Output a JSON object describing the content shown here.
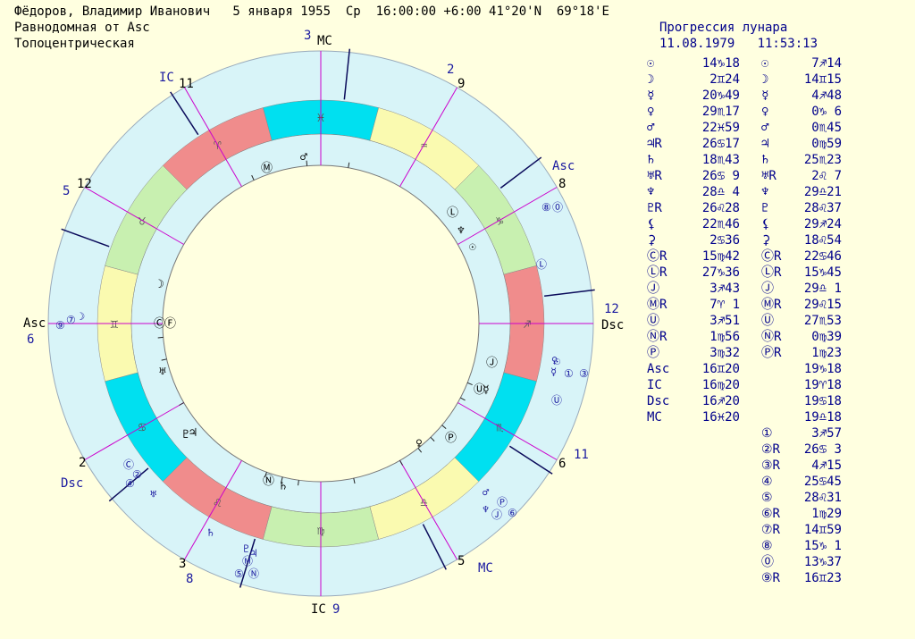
{
  "header": {
    "line1": "Фёдоров, Владимир Иванович   5 января 1955  Ср  16:00:00 +6:00 41°20'N  69°18'E",
    "line2": "Равнодомная от Asc",
    "line3": "Топоцентрическая"
  },
  "wheel": {
    "colors": {
      "outer_ring": "#d8f4f8",
      "fire": "#f08c8c",
      "earth": "#c8f0b0",
      "air": "#fafab0",
      "water": "#00e0f0",
      "inner_ring": "#d8f4f8",
      "background": "#ffffe0",
      "axis": "#cc00cc",
      "cusp_line": "#0a0a5a",
      "house_number": "#000000",
      "label_blue": "#1a1aa0"
    },
    "signs": [
      "♓",
      "♒",
      "♑",
      "♐",
      "♏",
      "♎",
      "♍",
      "♌",
      "♋",
      "♊",
      "♉",
      "♈"
    ],
    "outer_labels": [
      {
        "text": "3",
        "color": "#1a1aa0"
      },
      {
        "text": "MC",
        "color": "#000000"
      },
      {
        "text": "2",
        "color": "#1a1aa0"
      },
      {
        "text": "9",
        "color": "#000000"
      },
      {
        "text": "Asc",
        "color": "#1a1aa0"
      },
      {
        "text": "8",
        "color": "#000000"
      },
      {
        "text": "12",
        "color": "#1a1aa0"
      },
      {
        "text": "Dsc",
        "color": "#000000"
      },
      {
        "text": "11",
        "color": "#1a1aa0"
      },
      {
        "text": "6",
        "color": "#000000"
      },
      {
        "text": "MC",
        "color": "#1a1aa0"
      },
      {
        "text": "5",
        "color": "#000000"
      },
      {
        "text": "IC",
        "color": "#000000"
      },
      {
        "text": "9",
        "color": "#1a1aa0"
      },
      {
        "text": "3",
        "color": "#000000"
      },
      {
        "text": "8",
        "color": "#1a1aa0"
      },
      {
        "text": "2",
        "color": "#000000"
      },
      {
        "text": "Dsc",
        "color": "#1a1aa0"
      },
      {
        "text": "Asc",
        "color": "#000000"
      },
      {
        "text": "6",
        "color": "#1a1aa0"
      },
      {
        "text": "5",
        "color": "#1a1aa0"
      },
      {
        "text": "12",
        "color": "#000000"
      },
      {
        "text": "IC",
        "color": "#1a1aa0"
      },
      {
        "text": "11",
        "color": "#000000"
      }
    ],
    "inner_glyphs": [
      "♂",
      "Ⓜ",
      "Ⓛ",
      "♆",
      "☉",
      "☽",
      "Ⓒ",
      "♅",
      "♇",
      "Ⓝ",
      "♄",
      "♃",
      "♀",
      "☿",
      "Ⓙ",
      "Ⓤ",
      "Ⓟ",
      "Ⓕ"
    ],
    "outer_glyphs": [
      "☽",
      "⑦",
      "⑨",
      "②",
      "④",
      "Ⓒ",
      "♅",
      "♃",
      "♄",
      "⑤",
      "Ⓝ",
      "Ⓜ",
      "♇",
      "♆",
      "Ⓙ",
      "⑥",
      "Ⓟ",
      "♂",
      "☿",
      "♀",
      "Ⓛ",
      "⑧",
      "⓪",
      "①",
      "③",
      "Ⓤ",
      "☉"
    ]
  },
  "table": {
    "title_line1": "Прогрессия лунара",
    "title_line2": "11.08.1979   11:53:13",
    "rows": [
      {
        "l1": "☉",
        "v1": "14♑18",
        "l2": "☉",
        "v2": "7♐14"
      },
      {
        "l1": "☽",
        "v1": "2♊24",
        "l2": "☽",
        "v2": "14♊15"
      },
      {
        "l1": "☿",
        "v1": "20♑49",
        "l2": "☿",
        "v2": "4♐48"
      },
      {
        "l1": "♀",
        "v1": "29♏17",
        "l2": "♀",
        "v2": "0♑ 6"
      },
      {
        "l1": "♂",
        "v1": "22♓59",
        "l2": "♂",
        "v2": "0♏45"
      },
      {
        "l1": "♃R",
        "v1": "26♋17",
        "l2": "♃",
        "v2": "0♍59"
      },
      {
        "l1": "♄",
        "v1": "18♏43",
        "l2": "♄",
        "v2": "25♏23"
      },
      {
        "l1": "♅R",
        "v1": "26♋ 9",
        "l2": "♅R",
        "v2": "2♌ 7"
      },
      {
        "l1": "♆",
        "v1": "28♎ 4",
        "l2": "♆",
        "v2": "29♎21"
      },
      {
        "l1": "♇R",
        "v1": "26♌28",
        "l2": "♇",
        "v2": "28♌37"
      },
      {
        "l1": "⚸",
        "v1": "22♏46",
        "l2": "⚸",
        "v2": "29♐24"
      },
      {
        "l1": "⚳",
        "v1": "2♋36",
        "l2": "⚳",
        "v2": "18♌54"
      },
      {
        "l1": "ⒸR",
        "v1": "15♍42",
        "l2": "ⒸR",
        "v2": "22♋46"
      },
      {
        "l1": "ⓁR",
        "v1": "27♑36",
        "l2": "ⓁR",
        "v2": "15♑45"
      },
      {
        "l1": "Ⓙ",
        "v1": "3♐43",
        "l2": "Ⓙ",
        "v2": "29♎ 1"
      },
      {
        "l1": "ⓂR",
        "v1": "7♈ 1",
        "l2": "ⓂR",
        "v2": "29♌15"
      },
      {
        "l1": "Ⓤ",
        "v1": "3♐51",
        "l2": "Ⓤ",
        "v2": "27♏53"
      },
      {
        "l1": "ⓃR",
        "v1": "1♍56",
        "l2": "ⓃR",
        "v2": "0♍39"
      },
      {
        "l1": "Ⓟ",
        "v1": "3♍32",
        "l2": "ⓅR",
        "v2": "1♍23"
      },
      {
        "l1": "Asc",
        "v1": "16♊20",
        "l2": "",
        "v2": "19♑18"
      },
      {
        "l1": "IC",
        "v1": "16♍20",
        "l2": "",
        "v2": "19♈18"
      },
      {
        "l1": "Dsc",
        "v1": "16♐20",
        "l2": "",
        "v2": "19♋18"
      },
      {
        "l1": "MC",
        "v1": "16♓20",
        "l2": "",
        "v2": "19♎18"
      },
      {
        "l1": "",
        "v1": "",
        "l2": "①",
        "v2": "3♐57"
      },
      {
        "l1": "",
        "v1": "",
        "l2": "②R",
        "v2": "26♋ 3"
      },
      {
        "l1": "",
        "v1": "",
        "l2": "③R",
        "v2": "4♐15"
      },
      {
        "l1": "",
        "v1": "",
        "l2": "④",
        "v2": "25♋45"
      },
      {
        "l1": "",
        "v1": "",
        "l2": "⑤",
        "v2": "28♌31"
      },
      {
        "l1": "",
        "v1": "",
        "l2": "⑥R",
        "v2": "1♍29"
      },
      {
        "l1": "",
        "v1": "",
        "l2": "⑦R",
        "v2": "14♊59"
      },
      {
        "l1": "",
        "v1": "",
        "l2": "⑧",
        "v2": "15♑ 1"
      },
      {
        "l1": "",
        "v1": "",
        "l2": "⓪",
        "v2": "13♑37"
      },
      {
        "l1": "",
        "v1": "",
        "l2": "⑨R",
        "v2": "16♊23"
      }
    ]
  }
}
